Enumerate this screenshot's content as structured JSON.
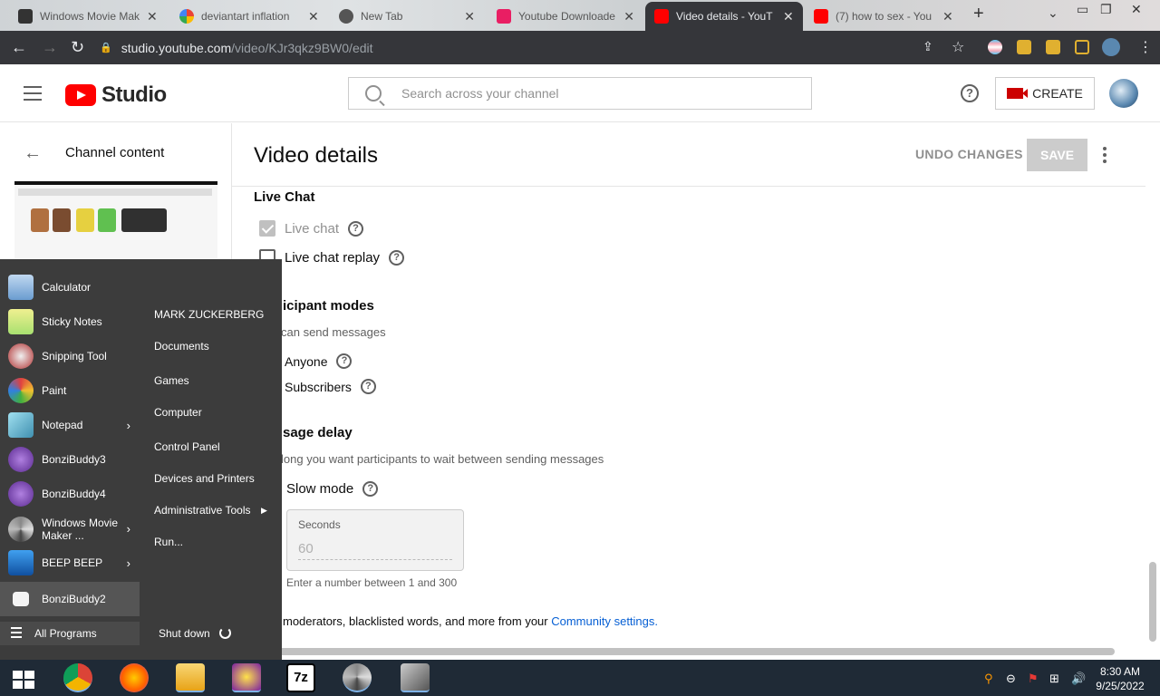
{
  "browser": {
    "tabs": [
      {
        "title": "Windows Movie Mak",
        "favicon": "film-icon"
      },
      {
        "title": "deviantart inflation",
        "favicon": "google-icon"
      },
      {
        "title": "New Tab",
        "favicon": "chrome-icon"
      },
      {
        "title": "Youtube Downloade",
        "favicon": "download-icon"
      },
      {
        "title": "Video details - YouT",
        "favicon": "youtube-icon"
      },
      {
        "title": "(7) how to sex - You",
        "favicon": "youtube-icon"
      }
    ],
    "active_tab": 4,
    "new_tab_label": "+",
    "url_host": "studio.youtube.com",
    "url_path": "/video/KJr3qkz9BW0/edit"
  },
  "header": {
    "logo_text": "Studio",
    "search_placeholder": "Search across your channel",
    "help_label": "?",
    "create_label": "CREATE"
  },
  "leftnav": {
    "back_label": "←",
    "title": "Channel content"
  },
  "main": {
    "page_title": "Video details",
    "undo_label": "UNDO CHANGES",
    "save_label": "SAVE",
    "live_chat": {
      "heading": "Live Chat",
      "live_chat_label": "Live chat",
      "live_chat_replay_label": "Live chat replay"
    },
    "participant_modes": {
      "heading": "icipant modes",
      "subtext": "can send messages",
      "options": [
        "Anyone",
        "Subscribers"
      ]
    },
    "message_delay": {
      "heading": "sage delay",
      "subtext": "long you want participants to wait between sending messages",
      "slow_mode_label": "Slow mode",
      "seconds_label": "Seconds",
      "seconds_value": "60",
      "help_text": "Enter a number between 1 and 300"
    },
    "community_text": "moderators, blacklisted words, and more from your ",
    "community_link": "Community settings."
  },
  "start_menu": {
    "programs": [
      {
        "label": "Calculator",
        "icon": "calculator-icon",
        "arrow": false
      },
      {
        "label": "Sticky Notes",
        "icon": "sticky-notes-icon",
        "arrow": false
      },
      {
        "label": "Snipping Tool",
        "icon": "snipping-tool-icon",
        "arrow": false
      },
      {
        "label": "Paint",
        "icon": "paint-icon",
        "arrow": false
      },
      {
        "label": "Notepad",
        "icon": "notepad-icon",
        "arrow": true
      },
      {
        "label": "BonziBuddy3",
        "icon": "bonzibuddy-icon",
        "arrow": false
      },
      {
        "label": "BonziBuddy4",
        "icon": "bonzibuddy-icon",
        "arrow": false
      },
      {
        "label": "Windows Movie Maker ...",
        "icon": "movie-maker-icon",
        "arrow": true
      },
      {
        "label": "BEEP BEEP",
        "icon": "beep-icon",
        "arrow": true
      },
      {
        "label": "BonziBuddy2",
        "icon": "file-icon",
        "arrow": false
      }
    ],
    "right_items": [
      {
        "label": "MARK ZUCKERBERG",
        "arrow": false
      },
      {
        "label": "Documents",
        "arrow": false
      },
      {
        "label": "Games",
        "arrow": false
      },
      {
        "label": "Computer",
        "arrow": false
      },
      {
        "label": "Control Panel",
        "arrow": false
      },
      {
        "label": "Devices and Printers",
        "arrow": false
      },
      {
        "label": "Administrative Tools",
        "arrow": true
      },
      {
        "label": "Run...",
        "arrow": false
      }
    ],
    "all_programs_label": "All Programs",
    "shutdown_label": "Shut down"
  },
  "taskbar": {
    "apps": [
      "chrome-icon",
      "firefox-icon",
      "folder-icon",
      "yahoo-messenger-icon",
      "7zip-icon",
      "movie-maker-icon",
      "bonzi-app-icon"
    ],
    "time": "8:30 AM",
    "date": "9/25/2022"
  },
  "colors": {
    "youtube_red": "#ff0000",
    "link_blue": "#065fd4",
    "startmenu_bg": "#3c3c3c",
    "taskbar_bg": "#1f2a36"
  }
}
